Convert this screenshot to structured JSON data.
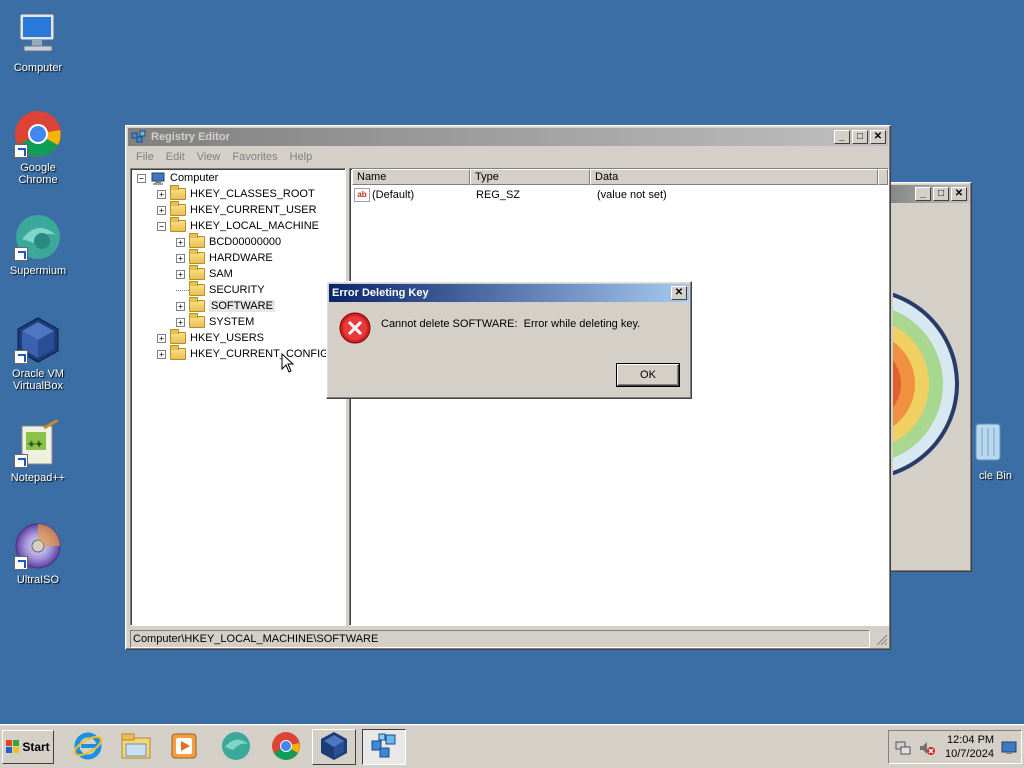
{
  "desktop": {
    "icons": [
      {
        "label": "Computer",
        "icon": "computer-icon"
      },
      {
        "label": "Google Chrome",
        "icon": "chrome-icon"
      },
      {
        "label": "Supermium",
        "icon": "supermium-icon"
      },
      {
        "label": "Oracle VM VirtualBox",
        "icon": "virtualbox-icon"
      },
      {
        "label": "Notepad++",
        "icon": "notepadpp-icon"
      },
      {
        "label": "UltraISO",
        "icon": "ultraiso-icon"
      }
    ],
    "partial_icon_label": "cle Bin"
  },
  "registry_editor": {
    "title": "Registry Editor",
    "menu": [
      "File",
      "Edit",
      "View",
      "Favorites",
      "Help"
    ],
    "tree": {
      "root": "Computer",
      "items": [
        {
          "label": "HKEY_CLASSES_ROOT",
          "expander": "+"
        },
        {
          "label": "HKEY_CURRENT_USER",
          "expander": "+"
        },
        {
          "label": "HKEY_LOCAL_MACHINE",
          "expander": "−"
        },
        {
          "label": "BCD00000000",
          "expander": "+"
        },
        {
          "label": "HARDWARE",
          "expander": "+"
        },
        {
          "label": "SAM",
          "expander": "+"
        },
        {
          "label": "SECURITY",
          "expander": ""
        },
        {
          "label": "SOFTWARE",
          "expander": "+"
        },
        {
          "label": "SYSTEM",
          "expander": "+"
        },
        {
          "label": "HKEY_USERS",
          "expander": "+"
        },
        {
          "label": "HKEY_CURRENT_CONFIG",
          "expander": "+"
        }
      ]
    },
    "columns": [
      "Name",
      "Type",
      "Data"
    ],
    "values": [
      {
        "name": "(Default)",
        "type": "REG_SZ",
        "data": "(value not set)",
        "icon": "ab"
      }
    ],
    "status": "Computer\\HKEY_LOCAL_MACHINE\\SOFTWARE"
  },
  "dialog": {
    "title": "Error Deleting Key",
    "message": "Cannot delete SOFTWARE:  Error while deleting key.",
    "ok_label": "OK"
  },
  "taskbar": {
    "start_label": "Start",
    "clock_time": "12:04 PM",
    "clock_date": "10/7/2024"
  }
}
